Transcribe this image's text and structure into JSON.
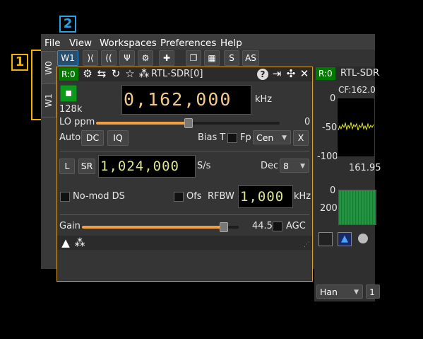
{
  "callouts": {
    "one": "1",
    "two": "2"
  },
  "menubar": {
    "file": "File",
    "view": "View",
    "workspaces": "Workspaces",
    "preferences": "Preferences",
    "help": "Help"
  },
  "toolbar": {
    "workspace": "W1",
    "s": "S",
    "as": "AS"
  },
  "workspace_tabs": {
    "w0": "W0",
    "w1": "W1"
  },
  "device": {
    "rx_tag": "R:0",
    "name": "RTL-SDR[0]",
    "center_freq": "0,162,000",
    "freq_unit": "kHz",
    "rate_label": "128k",
    "lo_label": "LO ppm",
    "lo_value": "0",
    "lo_fraction": 0.5,
    "auto_label": "Auto",
    "dc_label": "DC",
    "iq_label": "IQ",
    "bias_label": "Bias T",
    "fp_label": "Fp",
    "fp_value": "Cen",
    "x_label": "X",
    "l_label": "L",
    "sr_label": "SR",
    "sample_rate": "1,024,000",
    "sr_unit": "S/s",
    "dec_label": "Dec",
    "dec_value": "8",
    "nomod_label": "No-mod DS",
    "ofs_label": "Ofs",
    "rfbw_label": "RFBW",
    "rfbw_value": "1,000",
    "rfbw_unit": "kHz",
    "gain_label": "Gain",
    "gain_value": "44.5",
    "gain_fraction": 0.9,
    "agc_label": "AGC"
  },
  "spectrum": {
    "rx_tag": "R:0",
    "name": "RTL-SDR",
    "cf_label": "CF:162.0",
    "y_top": "0",
    "y_mid": "-50",
    "y_bot": "-100",
    "x_value": "161.95",
    "wf_top": "0",
    "wf_bot": "200",
    "window": "Han",
    "extra": "1"
  },
  "colors": {
    "accent": "#d49a2a",
    "rx_green": "#007b00",
    "callout": "#f0b400"
  }
}
